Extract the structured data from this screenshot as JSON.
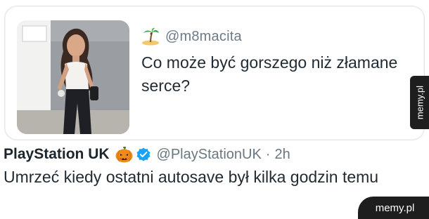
{
  "quoted_tweet": {
    "handle": "@m8macita",
    "text": "Co może być gorszego niż złamane serce?",
    "icons": {
      "emoji": "desert-island-icon",
      "photo": "photo-thumbnail"
    }
  },
  "tweet": {
    "author_name": "PlayStation UK",
    "author_emoji": "pumpkin-icon",
    "verified_icon": "verified-badge-icon",
    "handle": "@PlayStationUK",
    "separator": "·",
    "time": "2h",
    "text": "Umrzeć kiedy ostatni autosave był kilka godzin temu"
  },
  "watermarks": {
    "side": "memy.pl",
    "corner": "memy.pl"
  },
  "colors": {
    "text": "#1f2a33",
    "muted": "#6e7b86",
    "verified": "#1da1f2",
    "watermark_bg": "#1e1e1e"
  }
}
